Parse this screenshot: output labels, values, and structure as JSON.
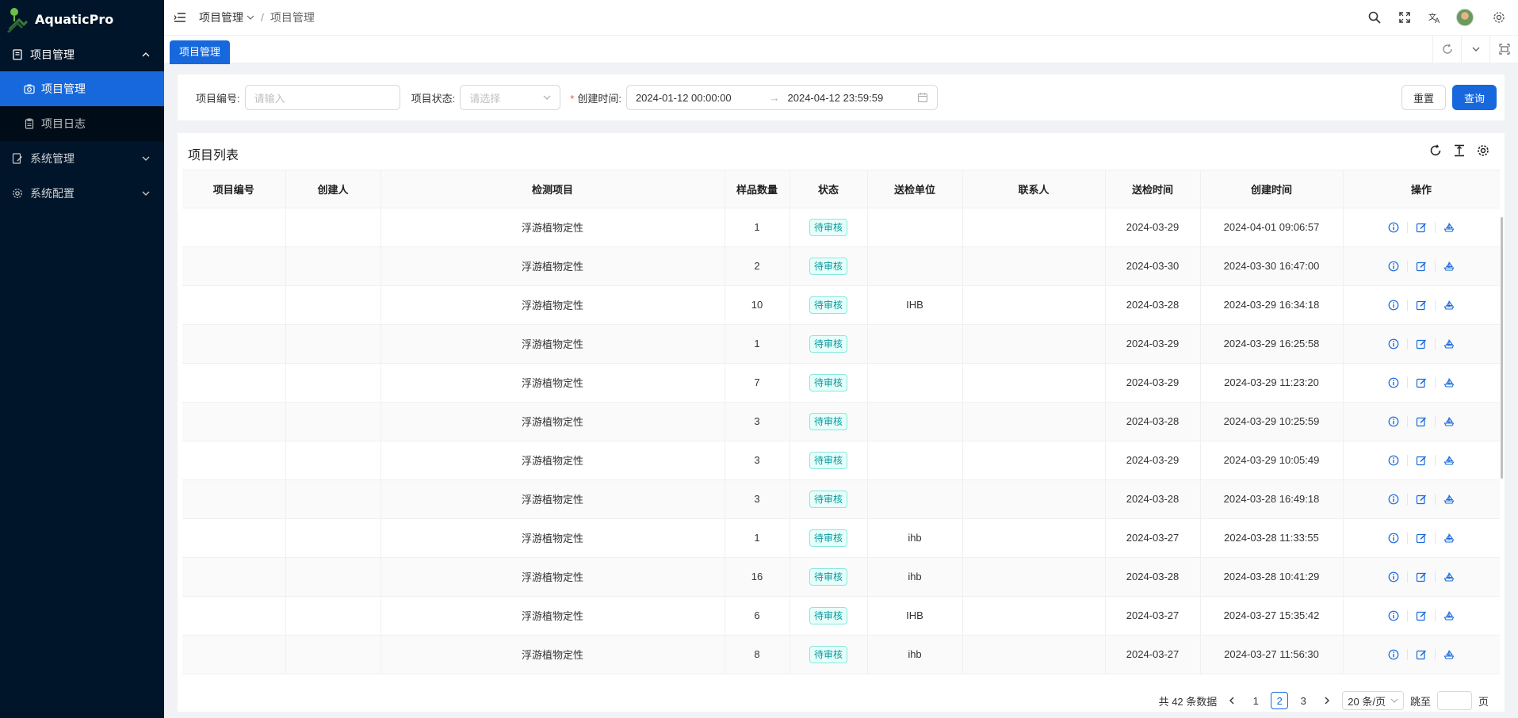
{
  "app": {
    "name": "AquaticPro"
  },
  "sidebar": {
    "groups": [
      {
        "label": "项目管理",
        "expanded": true,
        "icon": "book-icon",
        "items": [
          {
            "label": "项目管理",
            "active": true,
            "icon": "camera-icon"
          },
          {
            "label": "项目日志",
            "active": false,
            "icon": "clipboard-icon"
          }
        ]
      },
      {
        "label": "系统管理",
        "expanded": false,
        "icon": "edit-book-icon"
      },
      {
        "label": "系统配置",
        "expanded": false,
        "icon": "gear-icon"
      }
    ]
  },
  "header": {
    "breadcrumb": [
      "项目管理",
      "项目管理"
    ],
    "icons": [
      "search-icon",
      "fullscreen-icon",
      "translate-icon",
      "avatar",
      "settings-icon"
    ]
  },
  "tabs": [
    {
      "label": "项目管理",
      "active": true
    }
  ],
  "search": {
    "project_no_label": "项目编号:",
    "project_no_placeholder": "请输入",
    "status_label": "项目状态:",
    "status_placeholder": "请选择",
    "created_label": "创建时间:",
    "date_start": "2024-01-12 00:00:00",
    "date_end": "2024-04-12 23:59:59",
    "reset_label": "重置",
    "query_label": "查询"
  },
  "table": {
    "title": "项目列表",
    "columns": [
      "项目编号",
      "创建人",
      "检测项目",
      "样品数量",
      "状态",
      "送检单位",
      "联系人",
      "送检时间",
      "创建时间",
      "操作"
    ],
    "rows": [
      {
        "item": "浮游植物定性",
        "count": "1",
        "status": "待审核",
        "unit": "",
        "send": "2024-03-29",
        "created": "2024-04-01 09:06:57"
      },
      {
        "item": "浮游植物定性",
        "count": "2",
        "status": "待审核",
        "unit": "",
        "send": "2024-03-30",
        "created": "2024-03-30 16:47:00"
      },
      {
        "item": "浮游植物定性",
        "count": "10",
        "status": "待审核",
        "unit": "IHB",
        "send": "2024-03-28",
        "created": "2024-03-29 16:34:18"
      },
      {
        "item": "浮游植物定性",
        "count": "1",
        "status": "待审核",
        "unit": "",
        "send": "2024-03-29",
        "created": "2024-03-29 16:25:58"
      },
      {
        "item": "浮游植物定性",
        "count": "7",
        "status": "待审核",
        "unit": "",
        "send": "2024-03-29",
        "created": "2024-03-29 11:23:20"
      },
      {
        "item": "浮游植物定性",
        "count": "3",
        "status": "待审核",
        "unit": "",
        "send": "2024-03-28",
        "created": "2024-03-29 10:25:59"
      },
      {
        "item": "浮游植物定性",
        "count": "3",
        "status": "待审核",
        "unit": "",
        "send": "2024-03-29",
        "created": "2024-03-29 10:05:49"
      },
      {
        "item": "浮游植物定性",
        "count": "3",
        "status": "待审核",
        "unit": "",
        "send": "2024-03-28",
        "created": "2024-03-28 16:49:18"
      },
      {
        "item": "浮游植物定性",
        "count": "1",
        "status": "待审核",
        "unit": "ihb",
        "send": "2024-03-27",
        "created": "2024-03-28 11:33:55"
      },
      {
        "item": "浮游植物定性",
        "count": "16",
        "status": "待审核",
        "unit": "ihb",
        "send": "2024-03-28",
        "created": "2024-03-28 10:41:29"
      },
      {
        "item": "浮游植物定性",
        "count": "6",
        "status": "待审核",
        "unit": "IHB",
        "send": "2024-03-27",
        "created": "2024-03-27 15:35:42"
      },
      {
        "item": "浮游植物定性",
        "count": "8",
        "status": "待审核",
        "unit": "ihb",
        "send": "2024-03-27",
        "created": "2024-03-27 11:56:30"
      }
    ]
  },
  "pagination": {
    "total_text": "共 42 条数据",
    "pages": [
      "1",
      "2",
      "3"
    ],
    "current": "2",
    "page_size": "20 条/页",
    "jump_label": "跳至",
    "jump_suffix": "页"
  },
  "colors": {
    "sidebar_bg": "#001529",
    "primary": "#1668dc",
    "tag": "#08979c"
  }
}
